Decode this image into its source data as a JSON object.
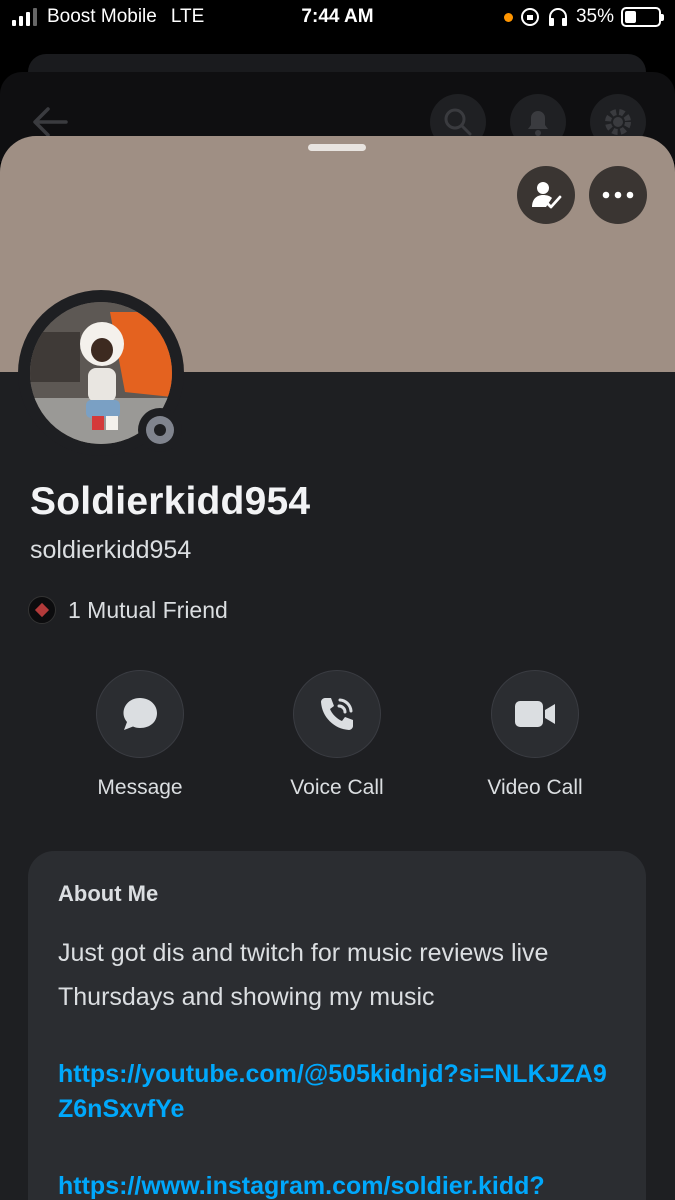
{
  "status_bar": {
    "carrier": "Boost Mobile",
    "network": "LTE",
    "time": "7:44 AM",
    "battery_percent": "35%",
    "battery_level": 0.35
  },
  "profile": {
    "display_name": "Soldierkidd954",
    "username": "soldierkidd954",
    "mutual_friends": "1 Mutual Friend",
    "status": "offline"
  },
  "actions": [
    {
      "label": "Message",
      "icon": "chat-bubble-icon"
    },
    {
      "label": "Voice Call",
      "icon": "phone-call-icon"
    },
    {
      "label": "Video Call",
      "icon": "video-camera-icon"
    }
  ],
  "about": {
    "title": "About Me",
    "text": "Just got dis and twitch for music reviews live Thursdays and showing my music",
    "link1": "https://youtube.com/@505kidnjd?si=NLKJZA9Z6nSxvfYe",
    "link2": "https://www.instagram.com/soldier.kidd?"
  },
  "colors": {
    "banner": "#9f8f84",
    "background": "#1e1f22",
    "card": "#2b2d31",
    "link": "#00a8fc",
    "offline_status": "#80848e"
  }
}
